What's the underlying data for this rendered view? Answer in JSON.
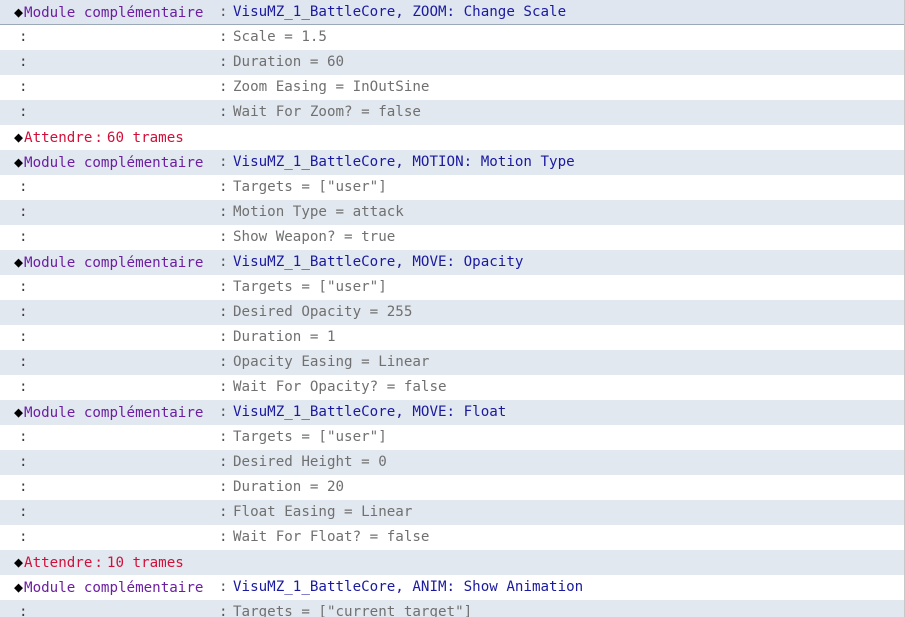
{
  "labels": {
    "plugin_command": "Module complémentaire",
    "wait": "Attendre",
    "separator": ":"
  },
  "rows": [
    {
      "type": "cmd",
      "text": "VisuMZ_1_BattleCore, ZOOM: Change Scale"
    },
    {
      "type": "param",
      "text": "Scale = 1.5"
    },
    {
      "type": "param",
      "text": "Duration = 60"
    },
    {
      "type": "param",
      "text": "Zoom Easing = InOutSine"
    },
    {
      "type": "param",
      "text": "Wait For Zoom? = false"
    },
    {
      "type": "wait",
      "text": "60 trames"
    },
    {
      "type": "cmd",
      "text": "VisuMZ_1_BattleCore, MOTION: Motion Type"
    },
    {
      "type": "param",
      "text": "Targets = [\"user\"]"
    },
    {
      "type": "param",
      "text": "Motion Type = attack"
    },
    {
      "type": "param",
      "text": "Show Weapon? = true"
    },
    {
      "type": "cmd",
      "text": "VisuMZ_1_BattleCore, MOVE: Opacity"
    },
    {
      "type": "param",
      "text": "Targets = [\"user\"]"
    },
    {
      "type": "param",
      "text": "Desired Opacity = 255"
    },
    {
      "type": "param",
      "text": "Duration = 1"
    },
    {
      "type": "param",
      "text": "Opacity Easing = Linear"
    },
    {
      "type": "param",
      "text": "Wait For Opacity? = false"
    },
    {
      "type": "cmd",
      "text": "VisuMZ_1_BattleCore, MOVE: Float"
    },
    {
      "type": "param",
      "text": "Targets = [\"user\"]"
    },
    {
      "type": "param",
      "text": "Desired Height = 0"
    },
    {
      "type": "param",
      "text": "Duration = 20"
    },
    {
      "type": "param",
      "text": "Float Easing = Linear"
    },
    {
      "type": "param",
      "text": "Wait For Float? = false"
    },
    {
      "type": "wait",
      "text": "10 trames"
    },
    {
      "type": "cmd",
      "text": "VisuMZ_1_BattleCore, ANIM: Show Animation"
    },
    {
      "type": "param",
      "text": "Targets = [\"current target\"]"
    }
  ]
}
